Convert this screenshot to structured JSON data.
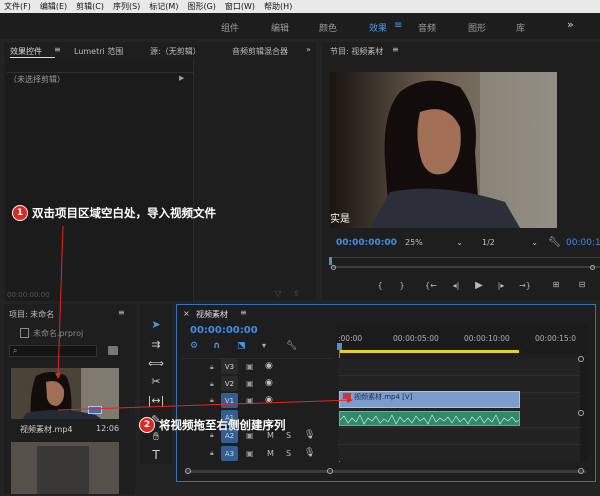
{
  "menu": [
    "文件(F)",
    "编辑(E)",
    "剪辑(C)",
    "序列(S)",
    "标记(M)",
    "图形(G)",
    "窗口(W)",
    "帮助(H)"
  ],
  "workspaces": {
    "tabs": [
      "组件",
      "编辑",
      "颜色",
      "效果",
      "音频",
      "图形",
      "库"
    ],
    "active": "效果",
    "more": "»"
  },
  "effect_panel": {
    "tabs": [
      "效果控件",
      "Lumetri 范围",
      "源:（无剪辑）",
      "音频剪辑混合器"
    ],
    "no_clip": "（未选择剪辑）",
    "timecode": "00:00:00:00"
  },
  "program": {
    "title": "节目: 视频素材",
    "subtitle": "实是",
    "timecode": "00:00:00:00",
    "zoom": "25%",
    "resolution": "1/2",
    "timecode_right": "00:00:1"
  },
  "project": {
    "title": "项目: 未命名",
    "file": "未命名.prproj",
    "clip_name": "视频素材.mp4",
    "clip_duration": "12:06"
  },
  "timeline": {
    "tab": "视频素材",
    "timecode": "00:00:00:00",
    "ruler": [
      ":00:00",
      "00:00:05:00",
      "00:00:10:00",
      "00:00:15:0"
    ],
    "tracks": [
      "V3",
      "V2",
      "V1",
      "A1",
      "A2",
      "A3"
    ],
    "clip_label": "视频素材.mp4 [V]",
    "m_label": "M",
    "s_label": "S"
  },
  "callouts": [
    {
      "number": "1",
      "text": "双击项目区域空白处，导入视频文件"
    },
    {
      "number": "2",
      "text": "将视频拖至右侧创建序列"
    }
  ],
  "colors": {
    "accent": "#3f8fe6",
    "callout_red": "#e3261f",
    "clip_blue": "#7b9ccd",
    "audio_green": "#2d8a6a"
  }
}
